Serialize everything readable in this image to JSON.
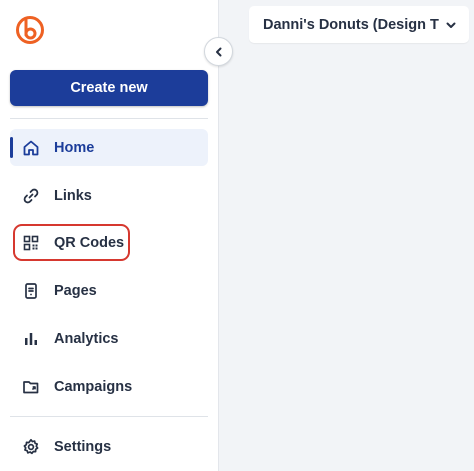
{
  "sidebar": {
    "logo_icon": "bitly-logo-icon",
    "create_label": "Create new",
    "items": [
      {
        "label": "Home",
        "icon": "home-icon",
        "active": true
      },
      {
        "label": "Links",
        "icon": "link-icon"
      },
      {
        "label": "QR Codes",
        "icon": "qr-code-icon"
      },
      {
        "label": "Pages",
        "icon": "page-icon"
      },
      {
        "label": "Analytics",
        "icon": "bar-chart-icon"
      },
      {
        "label": "Campaigns",
        "icon": "folder-icon"
      },
      {
        "label": "Settings",
        "icon": "gear-icon"
      }
    ]
  },
  "collapse_icon": "chevron-left-icon",
  "workspace": {
    "label": "Danni's Donuts (Design T…",
    "icon": "chevron-down-icon"
  },
  "colors": {
    "brand_orange": "#ee6123",
    "primary_blue": "#1c3d9a",
    "highlight_red": "#d6382f"
  }
}
